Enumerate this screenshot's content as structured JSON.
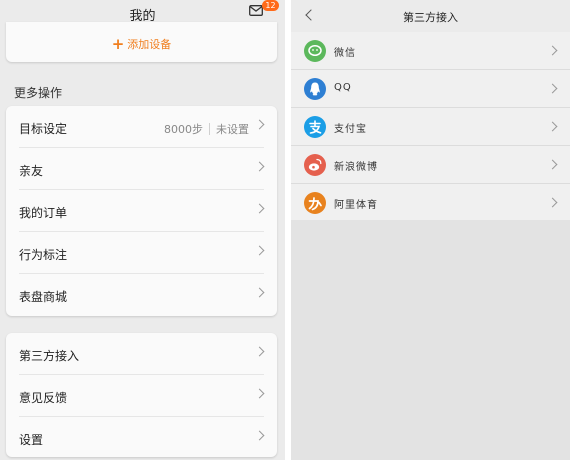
{
  "left": {
    "title": "我的",
    "mail_badge": "12",
    "add_device": "添加设备",
    "more_title": "更多操作",
    "more_items": [
      {
        "label": "目标设定",
        "value": "8000步",
        "status": "未设置"
      },
      {
        "label": "亲友"
      },
      {
        "label": "我的订单"
      },
      {
        "label": "行为标注"
      },
      {
        "label": "表盘商城"
      }
    ],
    "other_items": [
      {
        "label": "第三方接入"
      },
      {
        "label": "意见反馈"
      },
      {
        "label": "设置"
      }
    ]
  },
  "right": {
    "title": "第三方接入",
    "items": [
      {
        "label": "微信",
        "icon": "wechat-icon",
        "color": "#5cb85c"
      },
      {
        "label": "QQ",
        "icon": "qq-icon",
        "color": "#2e7fd3"
      },
      {
        "label": "支付宝",
        "icon": "alipay-icon",
        "color": "#1b9ee6"
      },
      {
        "label": "新浪微博",
        "icon": "weibo-icon",
        "color": "#e5604e"
      },
      {
        "label": "阿里体育",
        "icon": "ali-sports-icon",
        "color": "#e8821e"
      }
    ]
  }
}
